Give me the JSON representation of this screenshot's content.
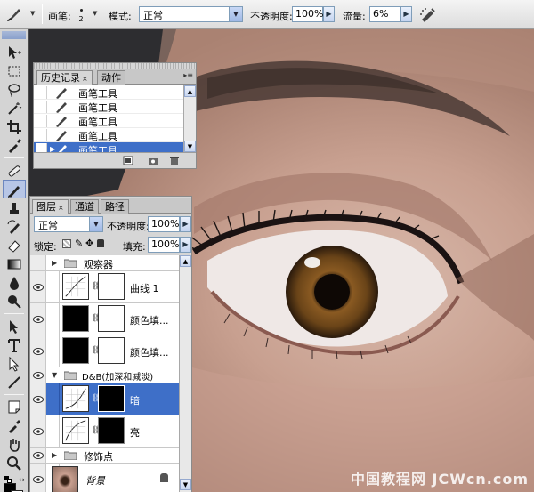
{
  "options_bar": {
    "brush_label": "画笔:",
    "brush_size": "2",
    "mode_label": "模式:",
    "mode_value": "正常",
    "opacity_label": "不透明度:",
    "opacity_value": "100%",
    "flow_label": "流量:",
    "flow_value": "6%"
  },
  "history_panel": {
    "tabs": [
      {
        "label": "历史记录",
        "active": true
      },
      {
        "label": "动作",
        "active": false
      }
    ],
    "items": [
      {
        "label": "画笔工具",
        "selected": false
      },
      {
        "label": "画笔工具",
        "selected": false
      },
      {
        "label": "画笔工具",
        "selected": false
      },
      {
        "label": "画笔工具",
        "selected": false
      },
      {
        "label": "画笔工具",
        "selected": true
      }
    ]
  },
  "layers_panel": {
    "tabs": [
      {
        "label": "图层",
        "active": true
      },
      {
        "label": "通道",
        "active": false
      },
      {
        "label": "路径",
        "active": false
      }
    ],
    "blend_mode": "正常",
    "opacity_label": "不透明度:",
    "opacity_value": "100%",
    "lock_label": "锁定:",
    "fill_label": "填充:",
    "fill_value": "100%",
    "layers": [
      {
        "name": "观察器",
        "kind": "group"
      },
      {
        "name": "曲线 1",
        "kind": "adjustment"
      },
      {
        "name": "颜色填...",
        "kind": "fill"
      },
      {
        "name": "颜色填...",
        "kind": "fill"
      },
      {
        "name": "D&B(加深和减淡)",
        "kind": "group"
      },
      {
        "name": "暗",
        "kind": "adjustment",
        "selected": true
      },
      {
        "name": "亮",
        "kind": "adjustment"
      },
      {
        "name": "修饰点",
        "kind": "group"
      },
      {
        "name": "背景",
        "kind": "background"
      }
    ]
  },
  "watermark": "中国教程网 JCWcn.com",
  "colors": {
    "selection": "#3e6fc8",
    "panel_bg": "#d6d6d6",
    "foreground": "#000000",
    "background": "#ffffff"
  }
}
